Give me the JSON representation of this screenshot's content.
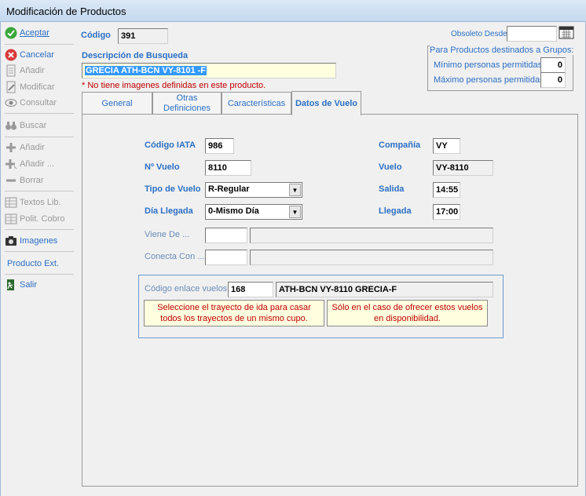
{
  "window": {
    "title": "Modificación de Productos"
  },
  "toolbar": {
    "aceptar": "Aceptar",
    "cancelar": "Cancelar",
    "anadir": "Añadir",
    "modificar": "Modificar",
    "consultar": "Consultar",
    "buscar": "Buscar",
    "anadir2": "Añadir",
    "anadir3": "Añadir ...",
    "borrar": "Borrar",
    "textos": "Textos Lib.",
    "polit": "Polit. Cobro",
    "imagenes": "Imagenes",
    "producto_ext": "Producto Ext.",
    "salir": "Salir"
  },
  "header": {
    "codigo_label": "Código",
    "codigo_value": "391",
    "descripcion_label": "Descripción de Busqueda",
    "descripcion_value": "GRECIA ATH-BCN VY-8101 -F",
    "warning": "* No tiene imagenes definidas en este producto.",
    "obsoleto_label": "Obsoleto Desde",
    "obsoleto_value": "",
    "grupos_title": "Para Productos destinados a Grupos:",
    "minimo_label": "Mínimo personas permitidas",
    "minimo_value": "0",
    "maximo_label": "Máximo personas permitidas",
    "maximo_value": "0"
  },
  "tabs": [
    {
      "label": "General"
    },
    {
      "label": "Otras Definiciones"
    },
    {
      "label": "Características"
    },
    {
      "label": "Datos de Vuelo"
    }
  ],
  "vuelo": {
    "iata_label": "Código IATA",
    "iata_value": "986",
    "nvuelo_label": "Nº Vuelo",
    "nvuelo_value": "8110",
    "tipo_label": "Tipo de Vuelo",
    "tipo_value": "R-Regular",
    "dia_label": "Día Llegada",
    "dia_value": "0-Mismo Día",
    "compania_label": "Compañía",
    "compania_value": "VY",
    "vuelo_label": "Vuelo",
    "vuelo_value": "VY-8110",
    "salida_label": "Salida",
    "salida_value": "14:55",
    "llegada_label": "Llegada",
    "llegada_value": "17:00",
    "viene_label": "Viene De ...",
    "conecta_label": "Conecta Con ...",
    "enlace_label": "Código enlace vuelos",
    "enlace_code": "168",
    "enlace_desc": "ATH-BCN VY-8110 GRECIA-F",
    "note1": "Seleccione el trayecto de ida para casar todos los trayectos de un mismo cupo.",
    "note2": "Sólo en el caso de ofrecer estos vuelos en disponibilidad."
  }
}
